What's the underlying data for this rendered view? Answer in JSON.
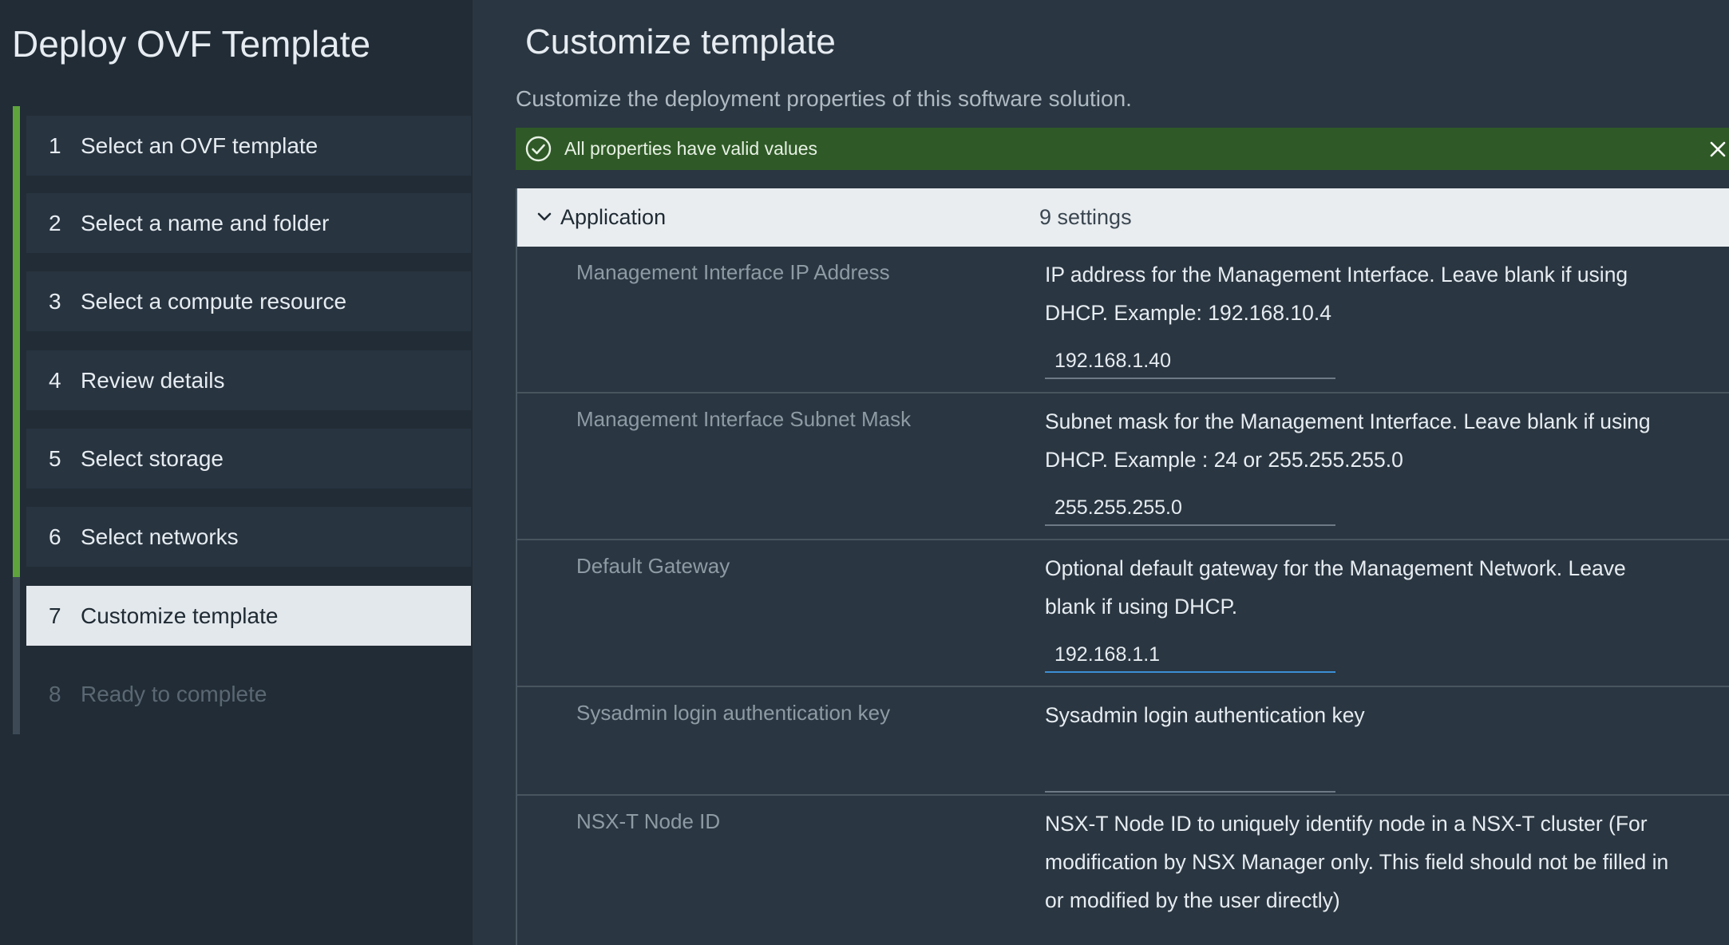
{
  "wizard": {
    "title": "Deploy OVF Template",
    "steps": [
      {
        "num": "1",
        "label": "Select an OVF template",
        "state": "done"
      },
      {
        "num": "2",
        "label": "Select a name and folder",
        "state": "done"
      },
      {
        "num": "3",
        "label": "Select a compute resource",
        "state": "done"
      },
      {
        "num": "4",
        "label": "Review details",
        "state": "done"
      },
      {
        "num": "5",
        "label": "Select storage",
        "state": "done"
      },
      {
        "num": "6",
        "label": "Select networks",
        "state": "done"
      },
      {
        "num": "7",
        "label": "Customize template",
        "state": "active"
      },
      {
        "num": "8",
        "label": "Ready to complete",
        "state": "disabled"
      }
    ]
  },
  "page": {
    "title": "Customize template",
    "subtitle": "Customize the deployment properties of this software solution."
  },
  "alert": {
    "text": "All properties have valid values",
    "icon": "check-circle-icon",
    "close_icon": "close-icon",
    "color": "#2f5a27"
  },
  "group": {
    "name": "Application",
    "count": "9 settings",
    "icon": "chevron-down-icon"
  },
  "properties": [
    {
      "label": "Management Interface IP Address",
      "description_line1": "IP address for the Management Interface. Leave blank if using",
      "description_line2": "DHCP. Example: 192.168.10.4",
      "value": "192.168.1.40"
    },
    {
      "label": "Management Interface Subnet Mask",
      "description_line1": "Subnet mask for the Management Interface. Leave blank if using",
      "description_line2": "DHCP. Example : 24 or 255.255.255.0",
      "value": "255.255.255.0"
    },
    {
      "label": "Default Gateway",
      "description_line1": "Optional default gateway for the Management Network. Leave",
      "description_line2": "blank if using DHCP.",
      "value": "192.168.1.1"
    },
    {
      "label": "Sysadmin login authentication key",
      "description_line1": "Sysadmin login authentication key",
      "value": ""
    },
    {
      "label": "NSX-T Node ID",
      "description_line1": "NSX-T Node ID to uniquely identify node in a NSX-T cluster (For",
      "description_line2": "modification by NSX Manager only. This field should not be filled in",
      "description_line3": "or modified by the user directly)"
    }
  ],
  "colors": {
    "progress_done": "#5fa33c",
    "focus_underline": "#3d8fd6",
    "active_step_bg": "#e3e8ec"
  }
}
